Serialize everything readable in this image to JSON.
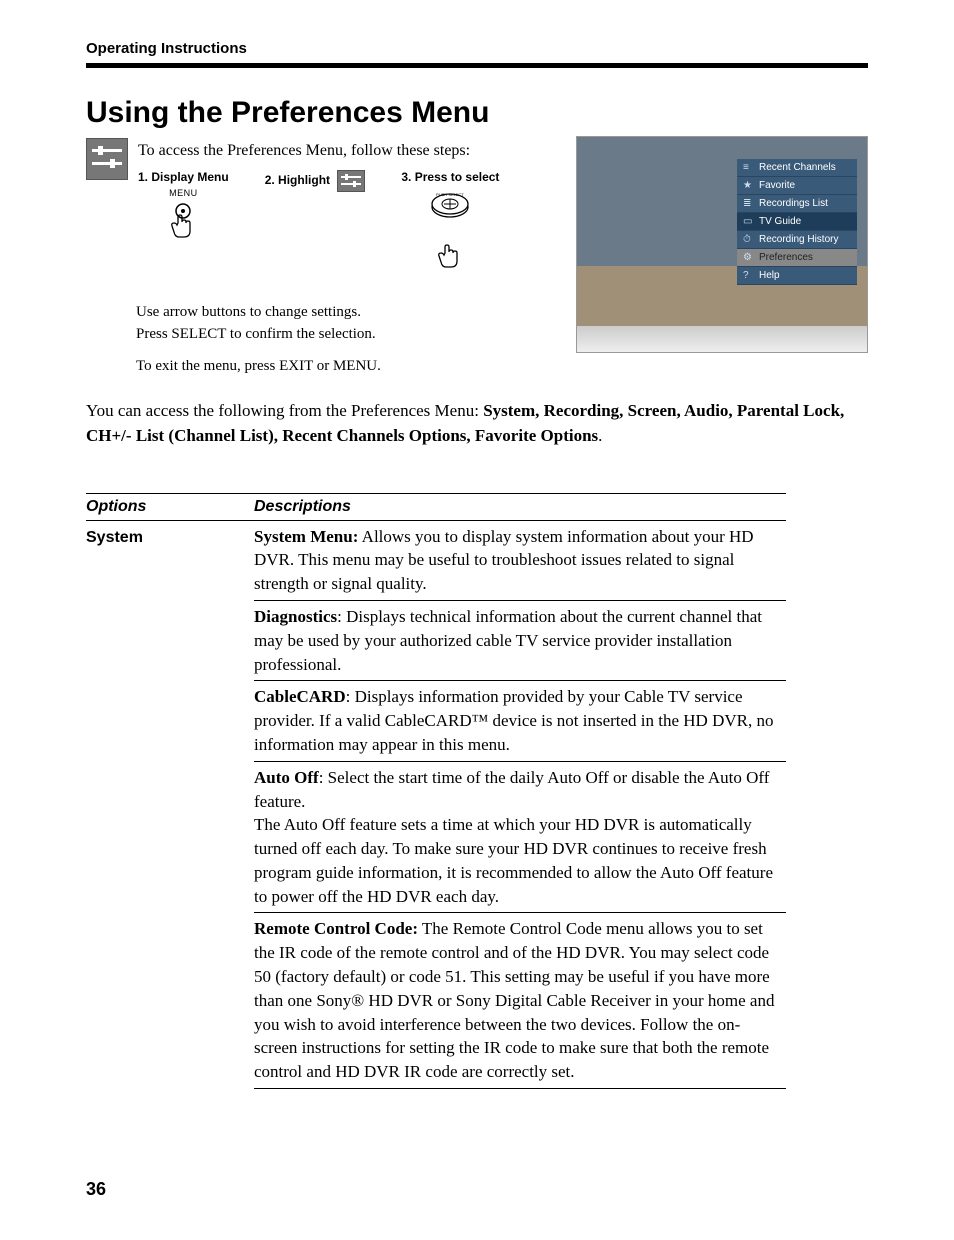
{
  "header": {
    "section": "Operating Instructions"
  },
  "title": "Using the Preferences Menu",
  "instructions": {
    "access_line": "To access the Preferences Menu, follow these steps:",
    "step1_label": "1. Display Menu",
    "step1_sub": "MENU",
    "step2_label": "2. Highlight",
    "step3_label": "3. Press  to select",
    "step3_sub": "PUSH SELECT",
    "arrow_line1": "Use arrow buttons to change settings.",
    "arrow_line2": "Press SELECT to confirm the selection.",
    "exit_line": "To exit the menu, press EXIT or MENU."
  },
  "tvmenu": {
    "items": [
      {
        "icon": "≡",
        "label": "Recent Channels"
      },
      {
        "icon": "★",
        "label": "Favorite"
      },
      {
        "icon": "≣",
        "label": "Recordings List"
      },
      {
        "icon": "▭",
        "label": "TV Guide"
      },
      {
        "icon": "⏱",
        "label": "Recording History"
      },
      {
        "icon": "⚙",
        "label": "Preferences"
      },
      {
        "icon": "?",
        "label": "Help"
      }
    ]
  },
  "intro": {
    "lead": "You can access the following from the Preferences Menu: ",
    "bold": "System, Recording, Screen, Audio, Parental Lock, CH+/- List (Channel List), Recent Channels Options, Favorite Options",
    "tail": "."
  },
  "table": {
    "col1": "Options",
    "col2": "Descriptions",
    "row_name": "System",
    "rows": [
      {
        "bold": "System Menu:",
        "text": " Allows you to display system information about your HD DVR.  This menu may be useful to troubleshoot issues related to signal strength or signal quality."
      },
      {
        "bold": "Diagnostics",
        "text": ": Displays technical information about the current channel that may be used by your authorized cable TV service provider installation professional."
      },
      {
        "bold": "CableCARD",
        "text": ": Displays information provided by your Cable TV service provider.  If a valid CableCARD™ device is not inserted in the HD DVR, no information may appear in this menu."
      },
      {
        "bold": "Auto Off",
        "text": ": Select the start time of the daily Auto Off or disable the Auto Off feature.",
        "extra": "The Auto Off feature sets a time at which your HD DVR is automatically turned off each day.  To make sure your HD DVR continues to receive fresh program guide information, it is recommended to allow the Auto Off feature to power off the HD DVR each day."
      },
      {
        "bold": "Remote Control Code:",
        "text": " The Remote Control Code menu allows you to set the IR code of the remote control and of the HD DVR.  You may select code 50 (factory default) or code 51.  This setting may be useful if you have more than one Sony® HD DVR or Sony Digital Cable Receiver in your home and you wish to avoid interference between the two devices.  Follow the on-screen instructions for setting the IR code to make sure that both the remote control and HD DVR IR code are correctly set."
      }
    ]
  },
  "page_number": "36"
}
